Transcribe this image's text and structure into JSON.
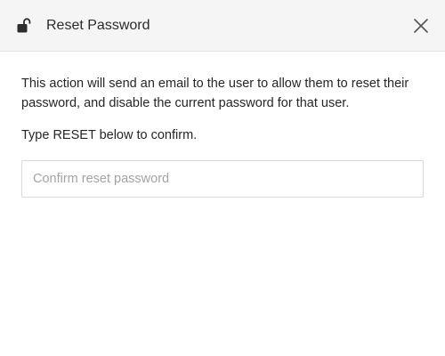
{
  "dialog": {
    "title": "Reset Password",
    "header_icon": "unlock-icon",
    "close_icon": "close-icon",
    "description": "This action will send an email to the user to allow them to reset their password, and disable the current password for that user.",
    "instruction": "Type RESET below to confirm.",
    "confirm_input": {
      "value": "",
      "placeholder": "Confirm reset password"
    }
  }
}
